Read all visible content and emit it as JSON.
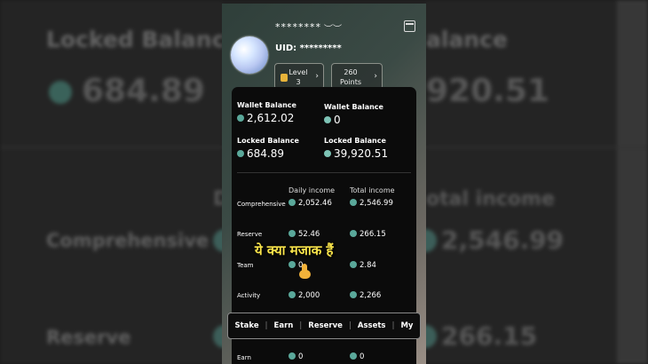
{
  "header": {
    "masked_name": "********",
    "uid_label": "UID: *********",
    "level_chip": {
      "line1": "Level",
      "line2": "3"
    },
    "points_chip": {
      "line1": "260",
      "line2": "Points"
    }
  },
  "balances": {
    "wallet_balance_1": {
      "label": "Wallet Balance",
      "value": "2,612.02"
    },
    "wallet_balance_2": {
      "label": "Wallet Balance",
      "value": "0"
    },
    "locked_balance_1": {
      "label": "Locked Balance",
      "value": "684.89"
    },
    "locked_balance_2": {
      "label": "Locked Balance",
      "value": "39,920.51"
    }
  },
  "income_table": {
    "headers": [
      "Daily income",
      "Total income"
    ],
    "rows": [
      {
        "label": "Comprehensive",
        "daily": "2,052.46",
        "total": "2,546.99"
      },
      {
        "label": "Reserve",
        "daily": "52.46",
        "total": "266.15"
      },
      {
        "label": "Team",
        "daily": "0",
        "total": "2.84"
      },
      {
        "label": "Activity",
        "daily": "2,000",
        "total": "2,266"
      },
      {
        "label": "Earn",
        "daily": "0",
        "total": "0"
      }
    ]
  },
  "overlay_caption": "ये क्या मजाक हैं",
  "tabs": [
    "Stake",
    "Earn",
    "Reserve",
    "Assets",
    "My"
  ],
  "background_echo": {
    "locked_balance": "Locked Balance",
    "locked_value": "684.89",
    "right_value": "920.51",
    "comprehensive": "Comprehensive",
    "reserve": "Reserve",
    "total_income": "otal income",
    "daily_partial": "Da",
    "right_total": "2,546.99",
    "right_reserve": "266.15",
    "right_top_label": "alance"
  },
  "colors": {
    "accent_coin": "#5aa89a",
    "caption": "#f7e24a",
    "panel": "#0b0b0b"
  }
}
